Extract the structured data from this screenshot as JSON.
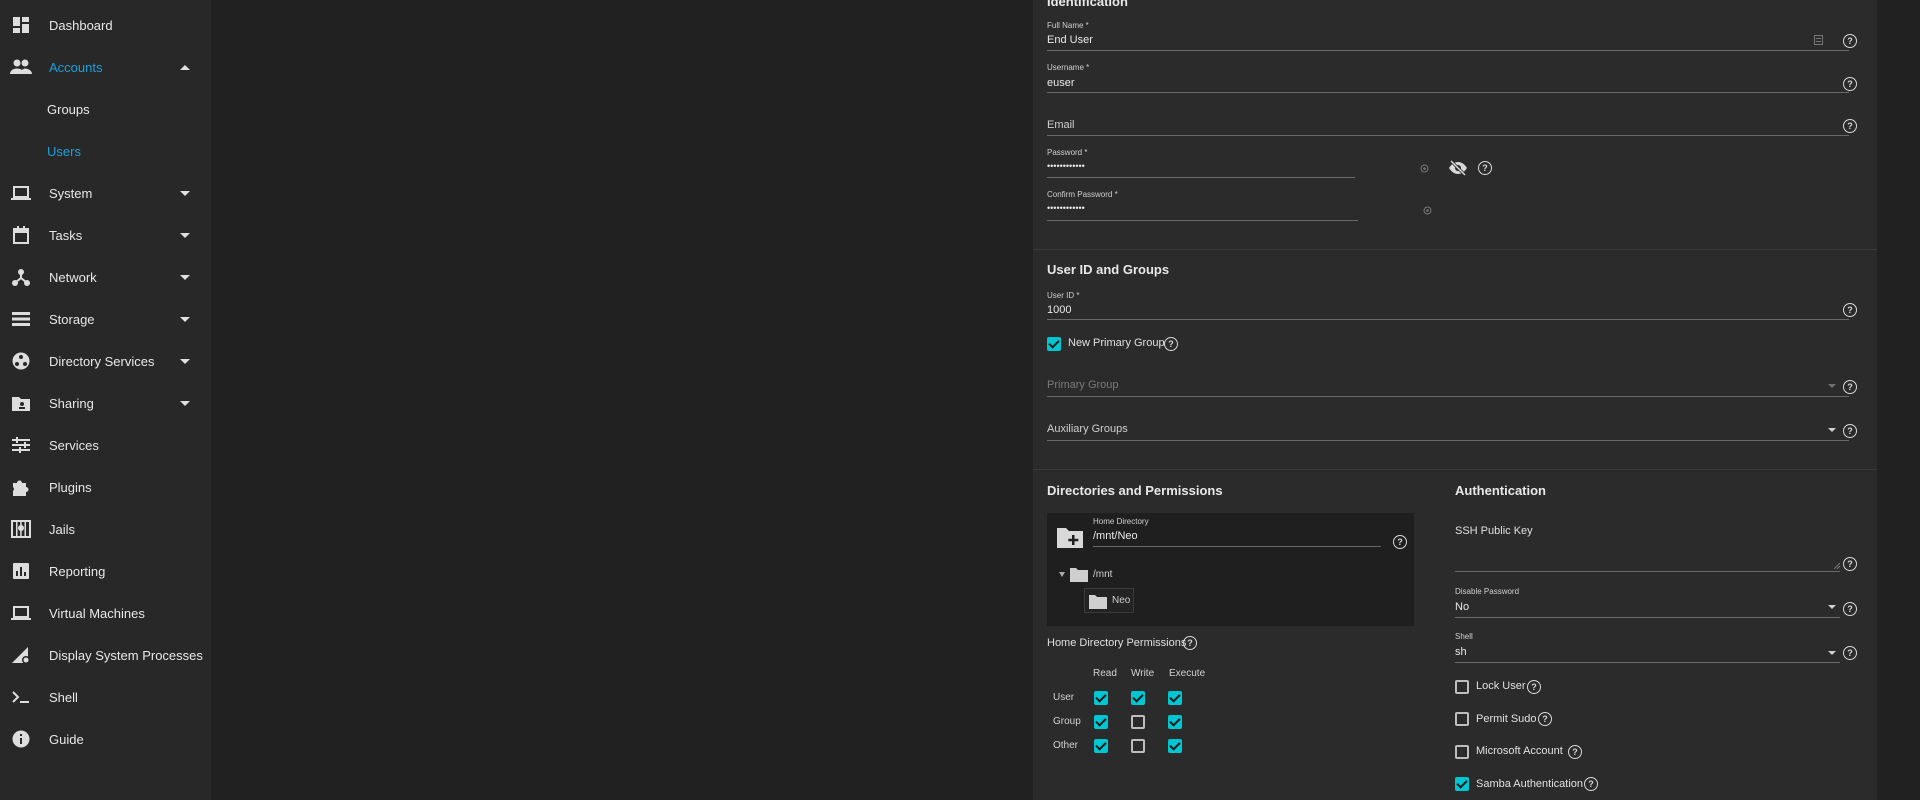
{
  "sidebar": {
    "items": [
      {
        "label": "Dashboard",
        "icon": "dashboard-icon"
      },
      {
        "label": "Accounts",
        "icon": "accounts-icon",
        "expanded": true,
        "active": true
      },
      {
        "label": "Groups",
        "sub": true
      },
      {
        "label": "Users",
        "sub": true,
        "active": true
      },
      {
        "label": "System",
        "icon": "laptop-icon"
      },
      {
        "label": "Tasks",
        "icon": "calendar-icon"
      },
      {
        "label": "Network",
        "icon": "network-icon"
      },
      {
        "label": "Storage",
        "icon": "storage-icon"
      },
      {
        "label": "Directory Services",
        "icon": "directory-services-icon"
      },
      {
        "label": "Sharing",
        "icon": "sharing-icon"
      },
      {
        "label": "Services",
        "icon": "tune-icon"
      },
      {
        "label": "Plugins",
        "icon": "puzzle-icon"
      },
      {
        "label": "Jails",
        "icon": "jail-icon"
      },
      {
        "label": "Reporting",
        "icon": "chart-icon"
      },
      {
        "label": "Virtual Machines",
        "icon": "laptop-icon"
      },
      {
        "label": "Display System Processes",
        "icon": "processes-icon"
      },
      {
        "label": "Shell",
        "icon": "terminal-icon"
      },
      {
        "label": "Guide",
        "icon": "info-icon"
      }
    ]
  },
  "identification": {
    "title": "Identification",
    "full_name": {
      "label": "Full Name *",
      "value": "End User"
    },
    "username": {
      "label": "Username *",
      "value": "euser"
    },
    "email": {
      "placeholder": "Email"
    },
    "password": {
      "label": "Password *",
      "value": "••••••••••••"
    },
    "confirm_password": {
      "label": "Confirm Password *",
      "value": "••••••••••••"
    }
  },
  "user_id_groups": {
    "title": "User ID and Groups",
    "user_id": {
      "label": "User ID *",
      "value": "1000"
    },
    "new_primary_group": {
      "label": "New Primary Group",
      "checked": true
    },
    "primary_group": {
      "placeholder": "Primary Group"
    },
    "auxiliary_groups": {
      "placeholder": "Auxiliary Groups"
    }
  },
  "dirs": {
    "title": "Directories and Permissions",
    "home_dir": {
      "label": "Home Directory",
      "value": "/mnt/Neo"
    },
    "tree": {
      "root": "/mnt",
      "child": "Neo"
    },
    "perm_title": "Home Directory Permissions",
    "perm_cols": [
      "Read",
      "Write",
      "Execute"
    ],
    "perm_rows": [
      {
        "name": "User",
        "values": [
          true,
          true,
          true
        ]
      },
      {
        "name": "Group",
        "values": [
          true,
          false,
          true
        ]
      },
      {
        "name": "Other",
        "values": [
          true,
          false,
          true
        ]
      }
    ]
  },
  "auth": {
    "title": "Authentication",
    "ssh_key": {
      "placeholder": "SSH Public Key"
    },
    "disable_password": {
      "label": "Disable Password",
      "value": "No"
    },
    "shell": {
      "label": "Shell",
      "value": "sh"
    },
    "options": [
      {
        "label": "Lock User",
        "checked": false
      },
      {
        "label": "Permit Sudo",
        "checked": false
      },
      {
        "label": "Microsoft Account",
        "checked": false
      },
      {
        "label": "Samba Authentication",
        "checked": true
      }
    ]
  },
  "colors": {
    "accent": "#1e9fd8",
    "checkbox": "#00c6d1"
  }
}
